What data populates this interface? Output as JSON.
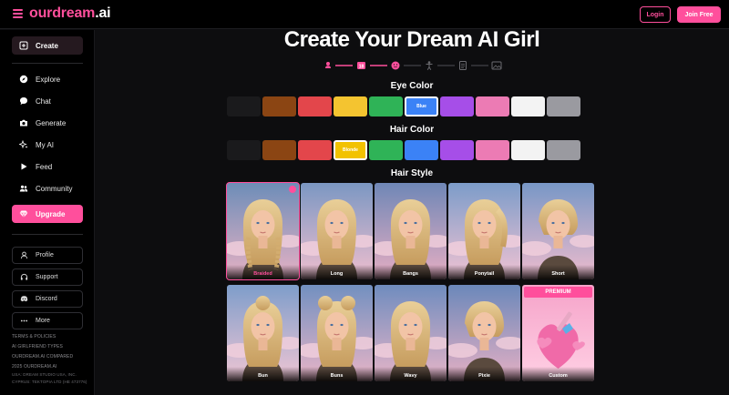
{
  "header": {
    "logo_a": "our",
    "logo_b": "dream",
    "logo_c": ".ai",
    "login": "Login",
    "join": "Join Free"
  },
  "sidebar": {
    "create": "Create",
    "items": [
      "Explore",
      "Chat",
      "Generate",
      "My AI",
      "Feed",
      "Community"
    ],
    "upgrade": "Upgrade",
    "boxes": [
      "Profile",
      "Support",
      "Discord",
      "More"
    ],
    "footer": [
      "TERMS & POLICIES",
      "AI GIRLFRIEND TYPES",
      "OURDREAM.AI COMPARED",
      "2025 OURDREAM.AI",
      "USA: DREAM STUDIO USA, INC.",
      "CYPRUS: TEKTOPIA LTD (HE 473776)"
    ]
  },
  "main": {
    "title": "Create Your Dream AI Girl",
    "eye_color_label": "Eye Color",
    "hair_color_label": "Hair Color",
    "hair_style_label": "Hair Style"
  },
  "colors": {
    "accent": "#ff4f9c",
    "eye_swatches": [
      "#1a1a1c",
      "#8b4513",
      "#e3464b",
      "#f4c430",
      "#2fb357",
      "#3b82f6",
      "#a64ee8",
      "#ec7bb4",
      "#f3f3f3",
      "#9a9aa0"
    ],
    "hair_swatches": [
      "#1a1a1c",
      "#8b4513",
      "#e3464b",
      "#f2c200",
      "#2fb357",
      "#3b82f6",
      "#a64ee8",
      "#ec7bb4",
      "#f3f3f3",
      "#9a9aa0"
    ]
  },
  "eye_selected_label": "Blue",
  "hair_selected_label": "Blonde",
  "hair_styles": [
    {
      "label": "Braided",
      "selected": true
    },
    {
      "label": "Long"
    },
    {
      "label": "Bangs"
    },
    {
      "label": "Ponytail"
    },
    {
      "label": "Short"
    },
    {
      "label": "Bun"
    },
    {
      "label": "Buns"
    },
    {
      "label": "Wavy"
    },
    {
      "label": "Pixie"
    },
    {
      "label": "Custom",
      "premium": "PREMIUM"
    }
  ]
}
